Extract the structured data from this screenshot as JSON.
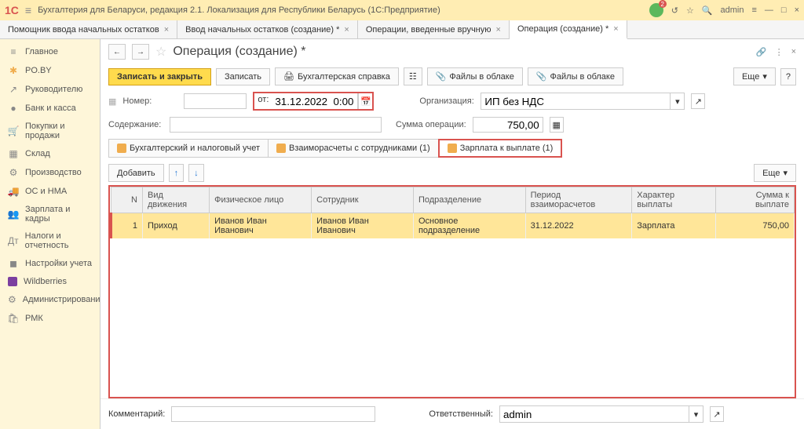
{
  "titlebar": {
    "app_title": "Бухгалтерия для Беларуси, редакция 2.1. Локализация для Республики Беларусь  (1С:Предприятие)",
    "user": "admin"
  },
  "tabs": [
    {
      "label": "Помощник ввода начальных остатков",
      "active": false
    },
    {
      "label": "Ввод начальных остатков (создание) *",
      "active": false
    },
    {
      "label": "Операции, введенные вручную",
      "active": false
    },
    {
      "label": "Операция (создание) *",
      "active": true
    }
  ],
  "sidebar": [
    {
      "label": "Главное",
      "icon": "≡",
      "cls": ""
    },
    {
      "label": "PO.BY",
      "icon": "✱",
      "cls": "orange"
    },
    {
      "label": "Руководителю",
      "icon": "↗",
      "cls": ""
    },
    {
      "label": "Банк и касса",
      "icon": "●",
      "cls": ""
    },
    {
      "label": "Покупки и продажи",
      "icon": "🛒",
      "cls": ""
    },
    {
      "label": "Склад",
      "icon": "▦",
      "cls": ""
    },
    {
      "label": "Производство",
      "icon": "⚙",
      "cls": ""
    },
    {
      "label": "ОС и НМА",
      "icon": "🚚",
      "cls": ""
    },
    {
      "label": "Зарплата и кадры",
      "icon": "👥",
      "cls": ""
    },
    {
      "label": "Налоги и отчетность",
      "icon": "Дт",
      "cls": ""
    },
    {
      "label": "Настройки учета",
      "icon": "◼",
      "cls": ""
    },
    {
      "label": "Wildberries",
      "icon": "",
      "cls": "purple"
    },
    {
      "label": "Администрирование",
      "icon": "⚙",
      "cls": ""
    },
    {
      "label": "РМК",
      "icon": "🛍",
      "cls": ""
    }
  ],
  "page_title": "Операция (создание) *",
  "toolbar": {
    "save_close": "Записать и закрыть",
    "save": "Записать",
    "acct_ref": "Бухгалтерская справка",
    "cloud1": "Файлы в облаке",
    "cloud2": "Файлы в облаке",
    "more": "Еще"
  },
  "form": {
    "number_label": "Номер:",
    "date_label": "от:",
    "date_value": "31.12.2022  0:00:00",
    "org_label": "Организация:",
    "org_value": "ИП без НДС",
    "content_label": "Содержание:",
    "sum_label": "Сумма операции:",
    "sum_value": "750,00"
  },
  "subtabs": [
    {
      "label": "Бухгалтерский и налоговый учет",
      "active": false
    },
    {
      "label": "Взаиморасчеты с сотрудниками (1)",
      "active": false
    },
    {
      "label": "Зарплата к выплате (1)",
      "active": true
    }
  ],
  "table_toolbar": {
    "add": "Добавить",
    "more": "Еще"
  },
  "table": {
    "headers": [
      "N",
      "Вид движения",
      "Физическое лицо",
      "Сотрудник",
      "Подразделение",
      "Период взаиморасчетов",
      "Характер выплаты",
      "Сумма к выплате"
    ],
    "rows": [
      {
        "n": "1",
        "movement": "Приход",
        "person": "Иванов Иван Иванович",
        "employee": "Иванов Иван Иванович",
        "dept": "Основное подразделение",
        "period": "31.12.2022",
        "type": "Зарплата",
        "sum": "750,00"
      }
    ]
  },
  "footer": {
    "comment_label": "Комментарий:",
    "responsible_label": "Ответственный:",
    "responsible_value": "admin"
  }
}
